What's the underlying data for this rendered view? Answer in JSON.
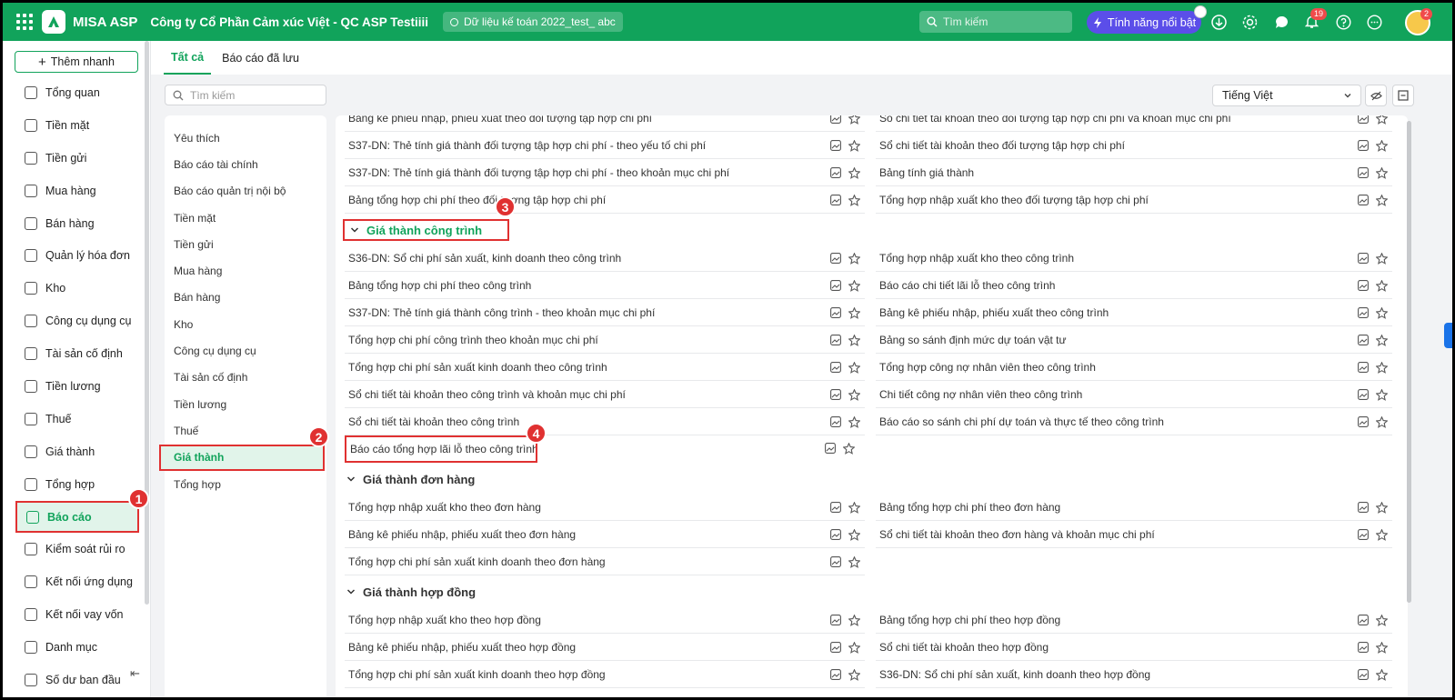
{
  "topbar": {
    "app_name": "MISA ASP",
    "company": "Công ty Cổ Phần Cảm xúc Việt - QC ASP Testiiii",
    "dataset": "Dữ liệu kế toán 2022_test_ abc",
    "search_placeholder": "Tìm kiếm",
    "featured": "Tính năng nổi bật",
    "notif_count": "19",
    "avatar_badge": "2",
    "brand_color": "#11a35b"
  },
  "sidebar": {
    "quick_add": "Thêm nhanh",
    "items": [
      {
        "label": "Tổng quan",
        "icon": "dashboard-icon"
      },
      {
        "label": "Tiền mặt",
        "icon": "cash-icon"
      },
      {
        "label": "Tiền gửi",
        "icon": "bank-icon"
      },
      {
        "label": "Mua hàng",
        "icon": "bag-icon"
      },
      {
        "label": "Bán hàng",
        "icon": "cart-icon"
      },
      {
        "label": "Quản lý hóa đơn",
        "icon": "invoice-icon"
      },
      {
        "label": "Kho",
        "icon": "warehouse-icon"
      },
      {
        "label": "Công cụ dụng cụ",
        "icon": "tools-icon"
      },
      {
        "label": "Tài sản cố định",
        "icon": "truck-icon"
      },
      {
        "label": "Tiền lương",
        "icon": "salary-icon"
      },
      {
        "label": "Thuế",
        "icon": "tax-icon"
      },
      {
        "label": "Giá thành",
        "icon": "cost-icon"
      },
      {
        "label": "Tổng hợp",
        "icon": "summary-icon"
      },
      {
        "label": "Báo cáo",
        "icon": "report-icon"
      },
      {
        "label": "Kiểm soát rủi ro",
        "icon": "risk-icon"
      },
      {
        "label": "Kết nối ứng dụng",
        "icon": "connect-icon"
      },
      {
        "label": "Kết nối vay vốn",
        "icon": "loan-icon"
      },
      {
        "label": "Danh mục",
        "icon": "list-icon"
      },
      {
        "label": "Số dư ban đầu",
        "icon": "balance-icon"
      }
    ]
  },
  "tabs": [
    "Tất cả",
    "Báo cáo đã lưu"
  ],
  "content_search_placeholder": "Tìm kiếm",
  "language": "Tiếng Việt",
  "categories": [
    "Yêu thích",
    "Báo cáo tài chính",
    "Báo cáo quản trị nội bộ",
    "Tiền mặt",
    "Tiền gửi",
    "Mua hàng",
    "Bán hàng",
    "Kho",
    "Công cụ dụng cụ",
    "Tài sản cố định",
    "Tiền lương",
    "Thuế",
    "Giá thành",
    "Tổng hợp"
  ],
  "reports": {
    "top_rows": [
      [
        "Bảng kê phiếu nhập, phiếu xuất theo đối tượng tập hợp chi phí",
        "Sổ chi tiết tài khoản theo đối tượng tập hợp chi phí và khoản mục chi phí"
      ],
      [
        "S37-DN: Thẻ tính giá thành đối tượng tập hợp chi phí - theo yếu tố chi phí",
        "Sổ chi tiết tài khoản theo đối tượng tập hợp chi phí"
      ],
      [
        "S37-DN: Thẻ tính giá thành đối tượng tập hợp chi phí - theo khoản mục chi phí",
        "Bảng tính giá thành"
      ],
      [
        "Bảng tổng hợp chi phí theo đối tượng tập hợp chi phí",
        "Tổng hợp nhập xuất kho theo đối tượng tập hợp chi phí"
      ]
    ],
    "sections": [
      {
        "title": "Giá thành công trình",
        "rows": [
          [
            "S36-DN: Sổ chi phí sản xuất, kinh doanh theo công trình",
            "Tổng hợp nhập xuất kho theo công trình"
          ],
          [
            "Bảng tổng hợp chi phí theo công trình",
            "Báo cáo chi tiết lãi lỗ theo công trình"
          ],
          [
            "S37-DN: Thẻ tính giá thành công trình - theo khoản mục chi phí",
            "Bảng kê phiếu nhập, phiếu xuất theo công trình"
          ],
          [
            "Tổng hợp chi phí công trình theo khoản mục chi phí",
            "Bảng so sánh định mức dự toán vật tư"
          ],
          [
            "Tổng hợp chi phí sản xuất kinh doanh theo công trình",
            "Tổng hợp công nợ nhân viên theo công trình"
          ],
          [
            "Sổ chi tiết tài khoản theo công trình và khoản mục chi phí",
            "Chi tiết công nợ nhân viên theo công trình"
          ],
          [
            "Sổ chi tiết tài khoản theo công trình",
            "Báo cáo so sánh chi phí dự toán và thực tế theo công trình"
          ],
          [
            "Báo cáo tổng hợp lãi lỗ theo công trình",
            ""
          ]
        ]
      },
      {
        "title": "Giá thành đơn hàng",
        "rows": [
          [
            "Tổng hợp nhập xuất kho theo đơn hàng",
            "Bảng tổng hợp chi phí theo đơn hàng"
          ],
          [
            "Bảng kê phiếu nhập, phiếu xuất theo đơn hàng",
            "Sổ chi tiết tài khoản theo đơn hàng và khoản mục chi phí"
          ],
          [
            "Tổng hợp chi phí sản xuất kinh doanh theo đơn hàng",
            ""
          ]
        ]
      },
      {
        "title": "Giá thành hợp đồng",
        "rows": [
          [
            "Tổng hợp nhập xuất kho theo hợp đồng",
            "Bảng tổng hợp chi phí theo hợp đồng"
          ],
          [
            "Bảng kê phiếu nhập, phiếu xuất theo hợp đồng",
            "Sổ chi tiết tài khoản theo hợp đồng"
          ],
          [
            "Tổng hợp chi phí sản xuất kinh doanh theo hợp đồng",
            "S36-DN: Sổ chi phí sản xuất, kinh doanh theo hợp đồng"
          ]
        ]
      }
    ]
  },
  "markers": [
    "1",
    "2",
    "3",
    "4"
  ]
}
